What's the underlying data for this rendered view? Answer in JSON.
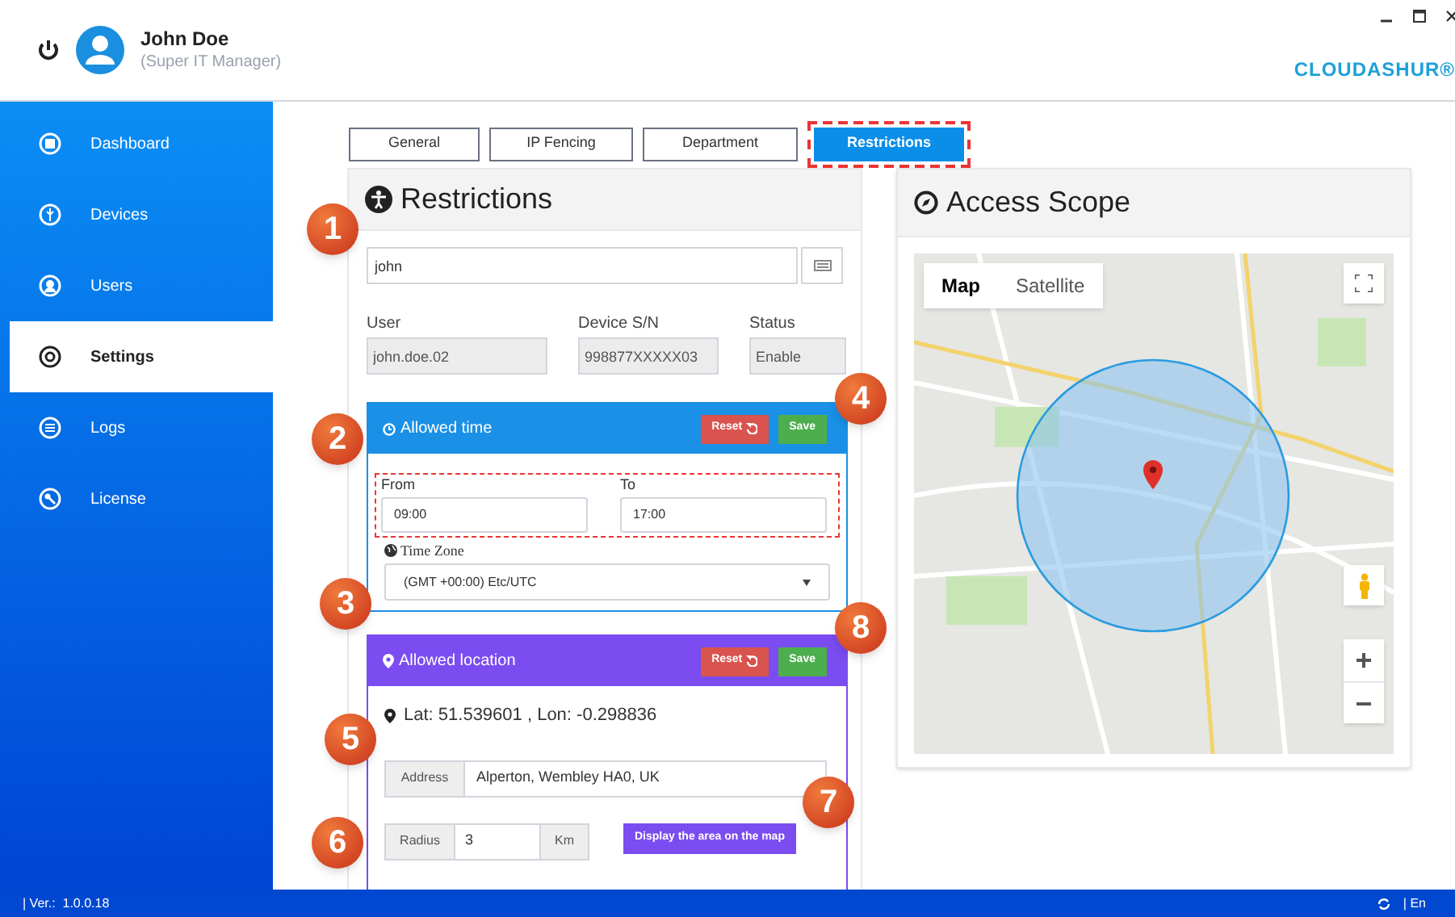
{
  "header": {
    "user_name": "John Doe",
    "role": "(Super IT Manager)",
    "logo": "CLOUDASHUR®"
  },
  "sidebar": {
    "items": [
      {
        "label": "Dashboard",
        "selected": false
      },
      {
        "label": "Devices",
        "selected": false
      },
      {
        "label": "Users",
        "selected": false
      },
      {
        "label": "Settings",
        "selected": true
      },
      {
        "label": "Logs",
        "selected": false
      },
      {
        "label": "License",
        "selected": false
      }
    ]
  },
  "tabs": [
    {
      "label": "General",
      "selected": false
    },
    {
      "label": "IP Fencing",
      "selected": false
    },
    {
      "label": "Department",
      "selected": false
    },
    {
      "label": "Restrictions",
      "selected": true
    }
  ],
  "restrictions": {
    "title": "Restrictions",
    "search_value": "john",
    "fields": [
      {
        "label": "User",
        "value": "john.doe.02"
      },
      {
        "label": "Device S/N",
        "value": "998877XXXXX03"
      },
      {
        "label": "Status",
        "value": "Enable"
      }
    ],
    "allowed_time": {
      "title": "Allowed time",
      "reset": "Reset",
      "save": "Save",
      "from": {
        "label": "From",
        "value": "09:00"
      },
      "to": {
        "label": "To",
        "value": "17:00"
      },
      "time_zone": {
        "label": "Time Zone",
        "value": "(GMT +00:00) Etc/UTC"
      }
    },
    "allowed_location": {
      "title": "Allowed location",
      "reset": "Reset",
      "save": "Save",
      "coordinates": "Lat: 51.539601 , Lon: -0.298836",
      "address": {
        "label": "Address",
        "value": "Alperton, Wembley HA0, UK"
      },
      "radius": {
        "label": "Radius",
        "value": "3",
        "unit": "Km"
      },
      "display_button": "Display the area on the map"
    }
  },
  "access_scope": {
    "title": "Access Scope",
    "map_types": [
      {
        "label": "Map",
        "selected": true
      },
      {
        "label": "Satellite",
        "selected": false
      }
    ],
    "zoom_in": "+",
    "zoom_out": "−"
  },
  "status_bar": {
    "version": "| Ver.:  1.0.0.18",
    "language": "| En"
  },
  "callouts": [
    "1",
    "2",
    "3",
    "4",
    "5",
    "6",
    "7",
    "8"
  ]
}
